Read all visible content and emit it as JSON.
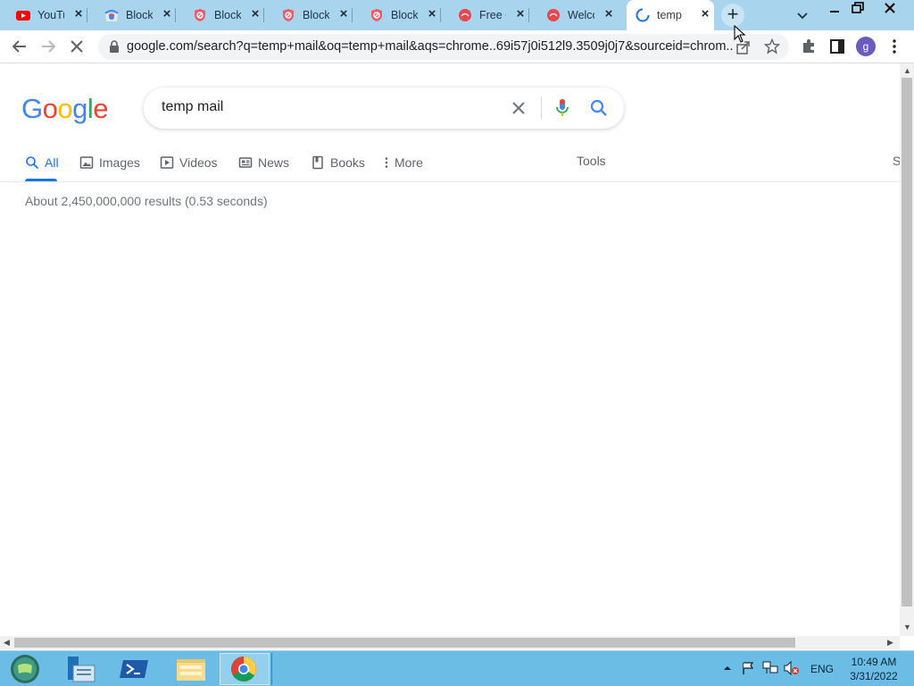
{
  "browser": {
    "tabs": [
      {
        "label": "YouTu",
        "favicon": "youtube-icon",
        "active": false
      },
      {
        "label": "BlockS",
        "favicon": "chrome-webstore-icon",
        "active": false
      },
      {
        "label": "Block",
        "favicon": "blocksite-shield-icon",
        "active": false
      },
      {
        "label": "BlockS",
        "favicon": "blocksite-shield-icon",
        "active": false
      },
      {
        "label": "Block",
        "favicon": "blocksite-shield-icon",
        "active": false
      },
      {
        "label": "Free C",
        "favicon": "red-circle-icon",
        "active": false
      },
      {
        "label": "Welco",
        "favicon": "red-circle-icon",
        "active": false
      },
      {
        "label": "temp",
        "favicon": "loading-spinner-icon",
        "active": true
      }
    ],
    "new_tab_label": "+",
    "url": "google.com/search?q=temp+mail&oq=temp+mail&aqs=chrome..69i57j0i512l9.3509j0j7&sourceid=chrom...",
    "profile_initial": "g"
  },
  "search": {
    "logo": {
      "letters": [
        "G",
        "o",
        "o",
        "g",
        "l",
        "e"
      ],
      "colors": [
        "#4285F4",
        "#EA4335",
        "#FBBC05",
        "#4285F4",
        "#34A853",
        "#EA4335"
      ]
    },
    "query": "temp mail",
    "tabs": [
      {
        "label": "All",
        "icon": "search-icon",
        "active": true
      },
      {
        "label": "Images",
        "icon": "image-icon",
        "active": false
      },
      {
        "label": "Videos",
        "icon": "play-icon",
        "active": false
      },
      {
        "label": "News",
        "icon": "news-icon",
        "active": false
      },
      {
        "label": "Books",
        "icon": "book-icon",
        "active": false
      },
      {
        "label": "More",
        "icon": "more-vert-icon",
        "active": false
      }
    ],
    "tools_label": "Tools",
    "safesearch_label": "S",
    "result_stats": "About 2,450,000,000 results (0.53 seconds)"
  },
  "taskbar": {
    "language": "ENG",
    "time": "10:49 AM",
    "date": "3/31/2022"
  },
  "colors": {
    "accent": "#1a73e8",
    "tabstrip": "#a8d4ee",
    "taskbar": "#6bbde6"
  }
}
